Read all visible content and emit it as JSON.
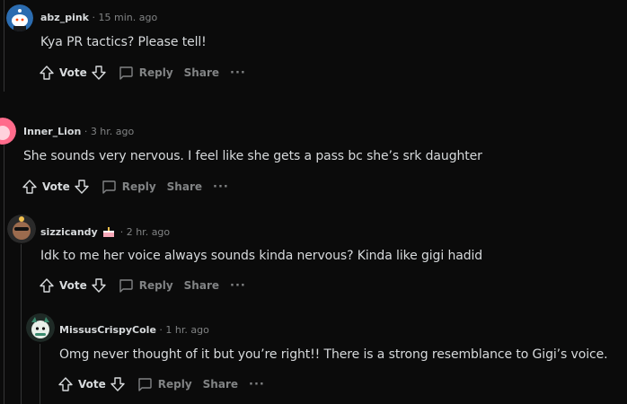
{
  "comments": [
    {
      "author": "abz_pink",
      "time": "15 min. ago",
      "body": "Kya PR tactics? Please tell!",
      "actions": {
        "vote": "Vote",
        "reply": "Reply",
        "share": "Share",
        "more": "···"
      },
      "avatar_color": "#2b6cb0"
    },
    {
      "author": "Inner_Lion",
      "time": "3 hr. ago",
      "body": "She sounds very nervous. I feel like she gets a pass bc she’s srk daughter",
      "actions": {
        "vote": "Vote",
        "reply": "Reply",
        "share": "Share",
        "more": "···"
      },
      "avatar_color": "#ff6b8b"
    },
    {
      "author": "sizzicandy",
      "time": "2 hr. ago",
      "body": "Idk to me her voice always sounds kinda nervous? Kinda like gigi hadid",
      "actions": {
        "vote": "Vote",
        "reply": "Reply",
        "share": "Share",
        "more": "···"
      },
      "avatar_color": "#9b6b4e"
    },
    {
      "author": "MissusCrispyCole",
      "time": "1 hr. ago",
      "body": "Omg never thought of it but you’re right!! There is a strong resemblance to Gigi’s voice.",
      "actions": {
        "vote": "Vote",
        "reply": "Reply",
        "share": "Share",
        "more": "···"
      },
      "avatar_color": "#3a8a6e"
    }
  ],
  "separator": "·"
}
